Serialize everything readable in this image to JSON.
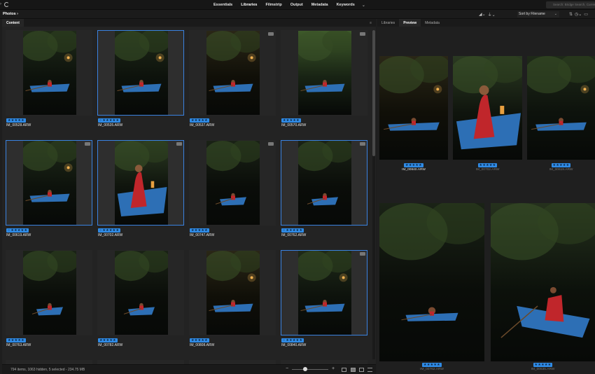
{
  "topbar": {
    "workspaces": [
      "Essentials",
      "Libraries",
      "Filmstrip",
      "Output",
      "Metadata",
      "Keywords"
    ],
    "active_workspace": "Libraries",
    "search_placeholder": "Search: Bridge Search, Current F..."
  },
  "pathbar": {
    "path": "Photos",
    "sort_label": "Sort by Filename"
  },
  "content_panel": {
    "tab": "Content"
  },
  "right_panel": {
    "tabs": [
      "Libraries",
      "Preview",
      "Metadata"
    ],
    "active_tab": "Preview"
  },
  "grid": {
    "items": [
      {
        "name": "IM_00528.ARW",
        "stars": "★★★★★",
        "selected": false,
        "ring": false,
        "badge": false,
        "scene": "boat-dark"
      },
      {
        "name": "IM_00535.ARW",
        "stars": "★★★★★",
        "selected": true,
        "ring": true,
        "badge": false,
        "scene": "boat-dark"
      },
      {
        "name": "IM_00537.ARW",
        "stars": "★★★★★",
        "selected": false,
        "ring": false,
        "badge": true,
        "scene": "boat-warm"
      },
      {
        "name": "IM_00570.ARW",
        "stars": "★★★★★",
        "selected": false,
        "ring": false,
        "badge": true,
        "scene": "boat-green"
      },
      {
        "name": "IM_00619.ARW",
        "stars": "★★★★★",
        "selected": true,
        "ring": true,
        "badge": true,
        "scene": "boat-dark"
      },
      {
        "name": "IM_00702.ARW",
        "stars": "★★★★★",
        "selected": true,
        "ring": true,
        "badge": true,
        "scene": "boat-close"
      },
      {
        "name": "IM_00747.ARW",
        "stars": "★★★★★",
        "selected": false,
        "ring": false,
        "badge": true,
        "scene": "boat-far"
      },
      {
        "name": "IM_00762.ARW",
        "stars": "★★★★★",
        "selected": true,
        "ring": true,
        "badge": true,
        "scene": "boat-far"
      },
      {
        "name": "IM_00763.ARW",
        "stars": "★★★★★",
        "selected": false,
        "ring": false,
        "badge": false,
        "scene": "boat-far"
      },
      {
        "name": "IM_00782.ARW",
        "stars": "★★★★★",
        "selected": false,
        "ring": false,
        "badge": false,
        "scene": "boat-far"
      },
      {
        "name": "IM_00808.ARW",
        "stars": "★★★★★",
        "selected": false,
        "ring": false,
        "badge": false,
        "scene": "boat-warm"
      },
      {
        "name": "IM_00840.ARW",
        "stars": "★★★★★",
        "selected": true,
        "ring": true,
        "badge": true,
        "scene": "boat-dark"
      }
    ]
  },
  "preview": {
    "items": [
      {
        "name": "IM_00840.ARW",
        "stars": "★★★★★",
        "dim": false,
        "scene": "boat-warm"
      },
      {
        "name": "IM_00702.ARW",
        "stars": "★★★★★",
        "dim": true,
        "scene": "boat-close"
      },
      {
        "name": "IM_00619.ARW",
        "stars": "★★★★★",
        "dim": true,
        "scene": "boat-dark"
      },
      {
        "name": "IM_00762.ARW",
        "stars": "★★★★★",
        "dim": true,
        "scene": "boat-far"
      },
      {
        "name": "IM_00535.ARW",
        "stars": "★★★★★",
        "dim": true,
        "scene": "boat-wide"
      }
    ]
  },
  "status": {
    "text": "794 items, 1063 hidden, 5 selected - 234.75 MB"
  },
  "colors": {
    "accent": "#2f8be6",
    "selection_border": "#3a82e0",
    "boat_blue": "#2d6fb5",
    "dress_red": "#c0262b"
  },
  "icons": [
    "refresh-icon",
    "search-icon",
    "filter-icon",
    "sort-order-icon",
    "view-grid-icon",
    "view-list-icon",
    "panel-menu-icon"
  ]
}
